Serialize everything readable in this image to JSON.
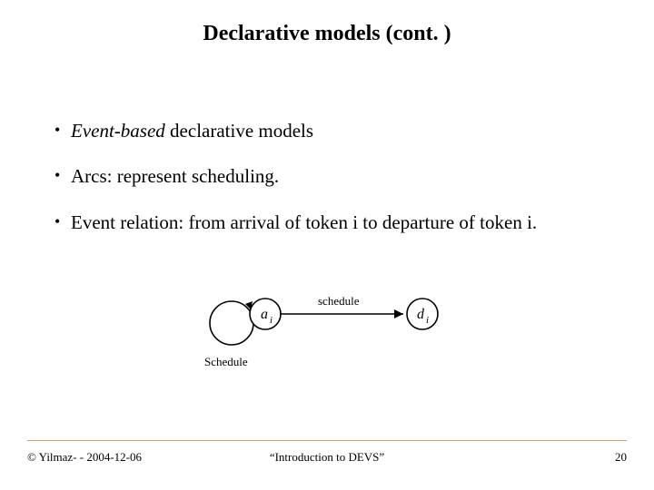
{
  "title": "Declarative models (cont. )",
  "bullets": {
    "b1_em": "Event-based",
    "b1_rest": " declarative models",
    "b2": "Arcs: represent scheduling.",
    "b3": "Event relation: from arrival of token i to departure of token i."
  },
  "diagram": {
    "node_a_sym": "a",
    "node_a_sub": "i",
    "node_d_sym": "d",
    "node_d_sub": "i",
    "edge_label": "schedule",
    "self_loop_label": "Schedule"
  },
  "footer": {
    "left": "© Yilmaz- -  2004-12-06",
    "center": "“Introduction to DEVS”",
    "right": "20"
  }
}
